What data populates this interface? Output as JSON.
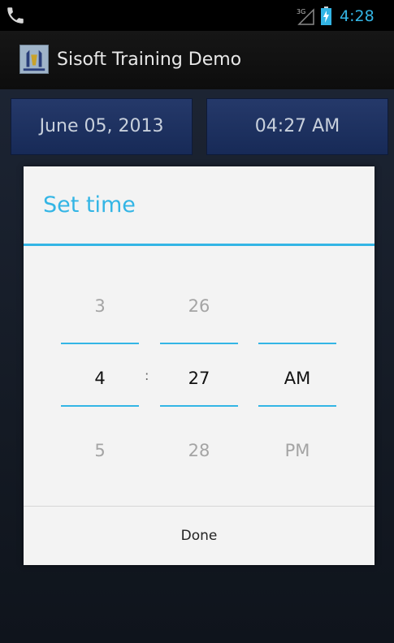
{
  "status_bar": {
    "signal_label": "3G",
    "time": "4:28",
    "accent_color": "#34b5e5"
  },
  "action_bar": {
    "title": "Sisoft Training Demo",
    "icon": "app-logo-icon"
  },
  "buttons": {
    "date_label": "June 05, 2013",
    "time_label": "04:27 AM"
  },
  "dialog": {
    "title": "Set time",
    "accent_color": "#33b5e5",
    "hour": {
      "prev": "3",
      "current": "4",
      "next": "5"
    },
    "separator": ":",
    "minute": {
      "prev": "26",
      "current": "27",
      "next": "28"
    },
    "ampm": {
      "prev": "",
      "current": "AM",
      "next": "PM"
    },
    "done_label": "Done"
  }
}
